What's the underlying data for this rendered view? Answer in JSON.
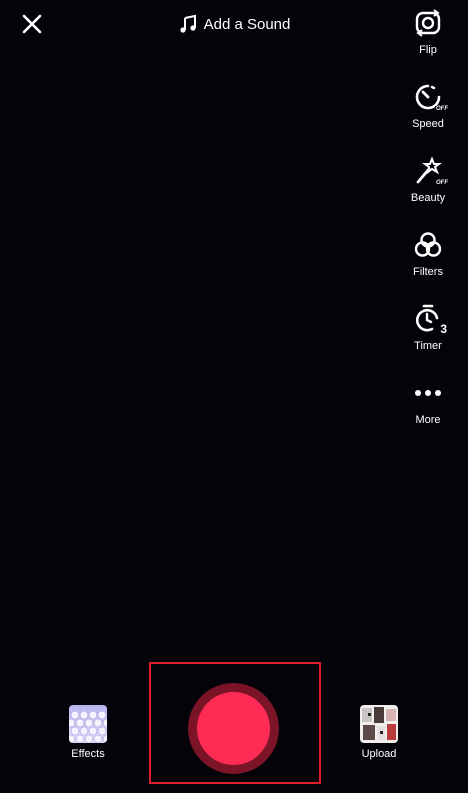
{
  "top": {
    "close_icon": "close-icon",
    "sound_label": "Add a Sound",
    "sound_icon": "music-note-icon"
  },
  "sidebar": {
    "items": [
      {
        "label": "Flip",
        "icon": "flip-camera-icon"
      },
      {
        "label": "Speed",
        "icon": "speed-icon",
        "badge": "OFF"
      },
      {
        "label": "Beauty",
        "icon": "beauty-wand-icon",
        "badge": "OFF"
      },
      {
        "label": "Filters",
        "icon": "filters-icon"
      },
      {
        "label": "Timer",
        "icon": "timer-icon",
        "badge": "3"
      },
      {
        "label": "More",
        "icon": "more-icon"
      }
    ]
  },
  "bottom": {
    "effects_label": "Effects",
    "upload_label": "Upload"
  },
  "colors": {
    "background": "#05030a",
    "record": "#fe2c55",
    "record_ring": "#7a1426",
    "highlight": "#e01e2b"
  }
}
